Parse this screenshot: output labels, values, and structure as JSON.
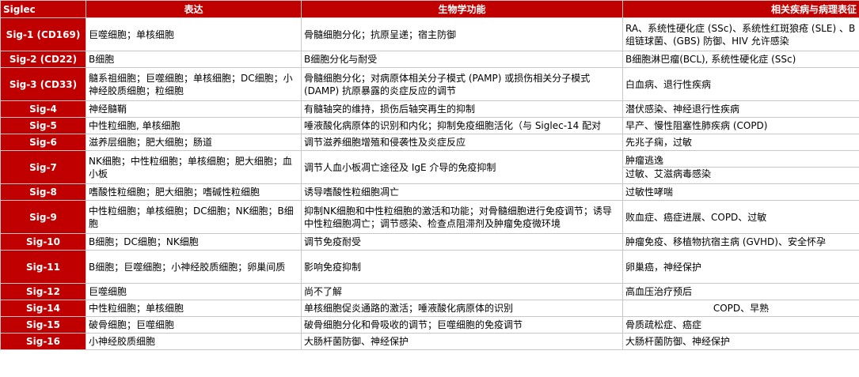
{
  "headers": {
    "siglec": "Siglec",
    "expression": "表达",
    "function": "生物学功能",
    "disease": "相关疾病与病理表征"
  },
  "rows": [
    {
      "name": "Sig-1 (CD169)",
      "expression": "巨噬细胞；单核细胞",
      "function": "骨髓细胞分化；抗原呈递；宿主防御",
      "disease": "RA、系统性硬化症 (SSc)、系统性红斑狼疮 (SLE) 、B组链球菌、(GBS) 防御、HIV 允许感染"
    },
    {
      "name": "Sig-2 (CD22)",
      "expression": "B细胞",
      "function": "B细胞分化与耐受",
      "disease": "B细胞淋巴瘤(BCL), 系统性硬化症 (SSc)"
    },
    {
      "name": "Sig-3 (CD33)",
      "expression": "髓系祖细胞；巨噬细胞；单核细胞；DC细胞；小神经胶质细胞；粒细胞",
      "function": "骨髓细胞分化；对病原体相关分子模式 (PAMP) 或损伤相关分子模式 (DAMP) 抗原暴露的炎症反应的调节",
      "disease": "白血病、退行性疾病"
    },
    {
      "name": "Sig-4",
      "expression": "神经髓鞘",
      "function": "有髓轴突的维持，损伤后轴突再生的抑制",
      "disease": "潜伏感染、神经退行性疾病"
    },
    {
      "name": "Sig-5",
      "expression": "中性粒细胞, 单核细胞",
      "function": "唾液酸化病原体的识别和内化；抑制免疫细胞活化（与 Siglec-14 配对",
      "disease": "早产、慢性阻塞性肺疾病 (COPD)"
    },
    {
      "name": "Sig-6",
      "expression": "滋养层细胞；肥大细胞；肠道",
      "function": "调节滋养细胞增殖和侵袭性及炎症反应",
      "disease": "先兆子痫，过敏"
    },
    {
      "name": "Sig-7",
      "expression": "NK细胞；中性粒细胞；单核细胞；肥大细胞；血小板",
      "function": "调节人血小板凋亡途径及 IgE 介导的免疫抑制",
      "disease": [
        "肿瘤逃逸",
        "过敏、艾滋病毒感染"
      ]
    },
    {
      "name": "Sig-8",
      "expression": "嗜酸性粒细胞；肥大细胞；嗜碱性粒细胞",
      "function": "诱导嗜酸性粒细胞凋亡",
      "disease": "过敏性哮喘"
    },
    {
      "name": "Sig-9",
      "expression": "中性粒细胞；单核细胞；DC细胞；NK细胞；B细胞",
      "function": "抑制NK细胞和中性粒细胞的激活和功能；对骨髓细胞进行免疫调节；诱导中性粒细胞凋亡；调节感染、检查点阻滞剂及肿瘤免疫微环境",
      "disease": "败血症、癌症进展、COPD、过敏"
    },
    {
      "name": "Sig-10",
      "expression": "B细胞；DC细胞；NK细胞",
      "function": "调节免疫耐受",
      "disease": "肿瘤免疫、移植物抗宿主病 (GVHD)、安全怀孕"
    },
    {
      "name": "Sig-11",
      "expression": "B细胞；巨噬细胞；小神经胶质细胞；卵巢间质",
      "function": "影响免疫抑制",
      "disease": "卵巢癌，神经保护"
    },
    {
      "name": "Sig-12",
      "expression": "巨噬细胞",
      "function": "尚不了解",
      "disease": "高血压治疗预后"
    },
    {
      "name": "Sig-14",
      "expression": "中性粒细胞；单核细胞",
      "function": "单核细胞促炎通路的激活；唾液酸化病原体的识别",
      "disease": "COPD、早熟"
    },
    {
      "name": "Sig-15",
      "expression": "破骨细胞；巨噬细胞",
      "function": "破骨细胞分化和骨吸收的调节；巨噬细胞的免疫调节",
      "disease": "骨质疏松症、癌症"
    },
    {
      "name": "Sig-16",
      "expression": " 小神经胶质细胞",
      "function": "大肠杆菌防御、神经保护",
      "disease": "大肠杆菌防御、神经保护"
    }
  ]
}
